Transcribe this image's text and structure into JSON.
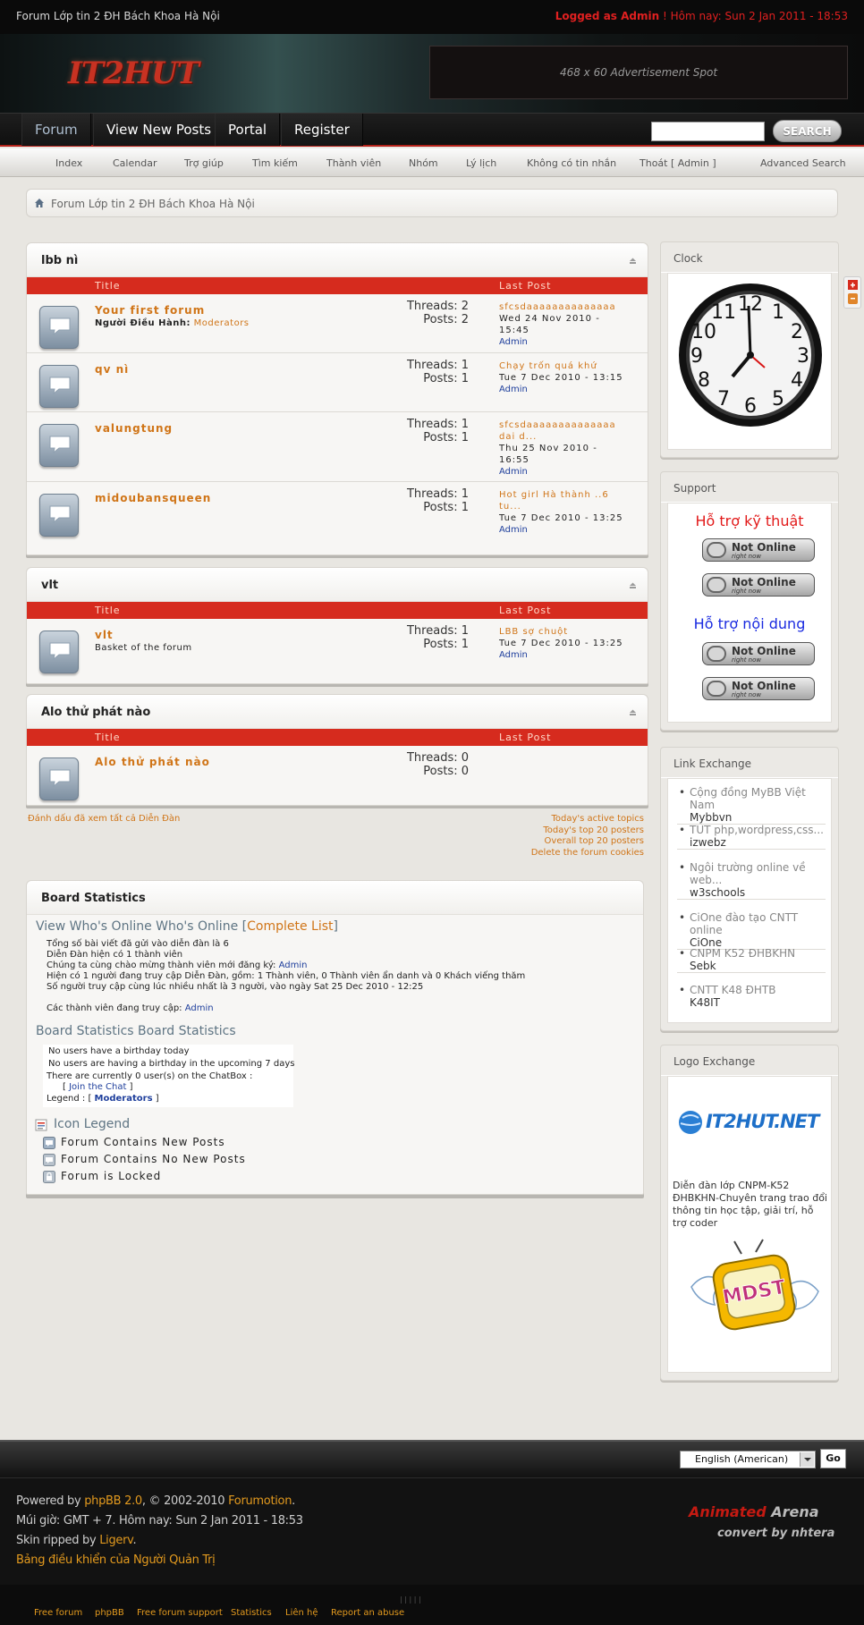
{
  "header": {
    "site_name": "Forum Lớp tin 2 ĐH Bách Khoa Hà Nội",
    "logged_as": "Logged as Admin",
    "today": " ! Hôm nay: Sun 2 Jan 2011 - 18:53",
    "logo_text_1": "IT2",
    "logo_text_2": "HUT",
    "ad_text": "468 x 60 Advertisement Spot"
  },
  "mainnav": {
    "tabs": [
      "Forum",
      "View New Posts",
      "Portal",
      "Register"
    ],
    "search_placeholder": "",
    "search_button": "SEARCH"
  },
  "subnav": [
    "Index",
    "Calendar",
    "Trợ giúp",
    "Tìm kiếm",
    "Thành viên",
    "Nhóm",
    "Lý lịch",
    "Không có tin nhắn",
    "Thoát [ Admin ]",
    "Advanced Search"
  ],
  "breadcrumb": "Forum Lớp tin 2 ĐH Bách Khoa Hà Nội",
  "columns": {
    "title": "Title",
    "last_post": "Last Post"
  },
  "categories": [
    {
      "name": "lbb nì",
      "forums": [
        {
          "name": "Your first forum",
          "desc_label": "Người Điều Hành:",
          "desc_link": "Moderators",
          "threads": "Threads: 2",
          "posts": "Posts: 2",
          "lp_title": "sfcsdaaaaaaaaaaaaaa",
          "lp_date": "Wed 24 Nov 2010 - 15:45",
          "lp_by": "Admin"
        },
        {
          "name": "qv nì",
          "desc_label": "",
          "desc_link": "",
          "threads": "Threads: 1",
          "posts": "Posts: 1",
          "lp_title": "Chạy trốn quá khứ",
          "lp_date": "Tue 7 Dec 2010 - 13:15",
          "lp_by": "Admin"
        },
        {
          "name": "valungtung",
          "desc_label": "",
          "desc_link": "",
          "threads": "Threads: 1",
          "posts": "Posts: 1",
          "lp_title": "sfcsdaaaaaaaaaaaaaa dai d...",
          "lp_date": "Thu 25 Nov 2010 - 16:55",
          "lp_by": "Admin"
        },
        {
          "name": "midoubansqueen",
          "desc_label": "",
          "desc_link": "",
          "threads": "Threads: 1",
          "posts": "Posts: 1",
          "lp_title": "Hot girl Hà thành ..6 tu...",
          "lp_date": "Tue 7 Dec 2010 - 13:25",
          "lp_by": "Admin"
        }
      ]
    },
    {
      "name": "vlt",
      "forums": [
        {
          "name": "vlt",
          "desc_label": "Basket of the forum",
          "desc_link": "",
          "threads": "Threads: 1",
          "posts": "Posts: 1",
          "lp_title": "LBB sợ chuột",
          "lp_date": "Tue 7 Dec 2010 - 13:25",
          "lp_by": "Admin"
        }
      ]
    },
    {
      "name": "Alo thử phát nào",
      "forums": [
        {
          "name": "Alo thử phát nào",
          "desc_label": "",
          "desc_link": "",
          "threads": "Threads: 0",
          "posts": "Posts: 0",
          "lp_title": "",
          "lp_date": "",
          "lp_by": ""
        }
      ]
    }
  ],
  "forum_footer": {
    "mark_read": "Đánh dấu đã xem tất cả Diễn Đàn",
    "links": [
      "Today's active topics",
      "Today's top 20 posters",
      "Overall top 20 posters",
      "Delete the forum cookies"
    ]
  },
  "stats": {
    "title": "Board Statistics",
    "online_title": "View Who's Online Who's Online",
    "online_link": "Complete List",
    "lines": [
      "Tổng số bài viết đã gửi vào diễn đàn là 6",
      "Diễn Đàn hiện có 1 thành viên",
      "Chúng ta cùng chào mừng thành viên mới đăng ký:",
      "Hiện có 1 người đang truy cập Diễn Đàn, gồm: 1 Thành viên, 0 Thành viên ẩn danh và 0 Khách viếng thăm",
      "Số người truy cập cùng lúc nhiều nhất là 3 người, vào ngày Sat 25 Dec 2010 - 12:25",
      "Các thành viên đang truy cập:"
    ],
    "newest_member": "Admin",
    "online_member": "Admin",
    "board_stats_title": "Board Statistics Board Statistics",
    "bday_today": "No users have a birthday today",
    "bday_upcoming": "No users are having a birthday in the upcoming 7 days",
    "chatbox": "There are currently 0 user(s) on the ChatBox :",
    "join_chat": "Join the Chat",
    "legend_label": "Legend :",
    "legend_link": "Moderators",
    "icon_legend_title": "Icon Legend",
    "icon_legend": [
      "Forum Contains New Posts",
      "Forum Contains No New Posts",
      "Forum is Locked"
    ]
  },
  "sidebar": {
    "clock_title": "Clock",
    "support_title": "Support",
    "support_tech": "Hỗ trợ kỹ thuật",
    "support_content": "Hỗ trợ nội dung",
    "status_main": "Not Online",
    "status_sub": "right now",
    "links_title": "Link Exchange",
    "links": [
      {
        "name": "Cộng đồng MyBB Việt Nam",
        "sub": "Mybbvn"
      },
      {
        "name": "TUT php,wordpress,css...",
        "sub": "izwebz"
      },
      {
        "name": "Ngôi trường online về web...",
        "sub": "w3schools"
      },
      {
        "name": "CiOne đào tạo CNTT online",
        "sub": "CiOne"
      },
      {
        "name": "CNPM K52 ĐHBKHN",
        "sub": "Sebk"
      },
      {
        "name": "CNTT K48 ĐHTB",
        "sub": "K48IT"
      }
    ],
    "logo_title": "Logo Exchange",
    "logo_text": "IT2HUT.NET",
    "logo_desc": "Diễn đàn lớp CNPM-K52 ĐHBKHN-Chuyên trang trao đổi thông tin học tập, giải trí, hỗ trợ coder",
    "mdst_text": "MDST"
  },
  "footer": {
    "language": "English (American)",
    "go": "Go",
    "powered_prefix": "Powered by ",
    "phpbb": "phpBB 2.0",
    "copyright": ", © 2002-2010 ",
    "forumotion": "Forumotion",
    "timezone": "Múi giờ: GMT + 7. Hôm nay: Sun 2 Jan 2011 - 18:53",
    "skin_prefix": "Skin ripped by ",
    "ligerv": "Ligerv",
    "admin_panel": "Bảng điều khiển của Người Quản Trị",
    "arena_1": "Animated",
    "arena_2": " Arena",
    "arena_sub": "convert by nhtera",
    "pipes": "| | | | |",
    "bottom_links": [
      "Free forum",
      "phpBB",
      "Free forum support",
      "Statistics",
      "Liên hệ",
      "Report an abuse"
    ]
  }
}
